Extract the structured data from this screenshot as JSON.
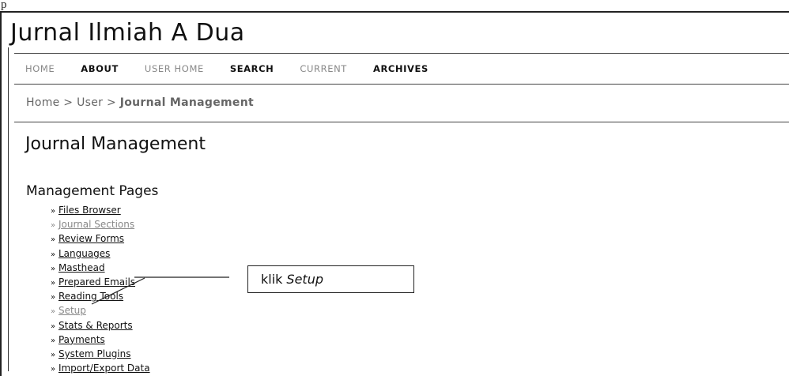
{
  "header": {
    "top_label": "p",
    "journal_title": "Jurnal Ilmiah A Dua"
  },
  "nav": {
    "items": [
      {
        "label": "HOME",
        "style": "muted"
      },
      {
        "label": "ABOUT",
        "style": "active"
      },
      {
        "label": "USER HOME",
        "style": "muted"
      },
      {
        "label": "SEARCH",
        "style": "active"
      },
      {
        "label": "CURRENT",
        "style": "muted"
      },
      {
        "label": "ARCHIVES",
        "style": "active"
      }
    ]
  },
  "breadcrumb": {
    "home": "Home",
    "sep1": " > ",
    "user": "User",
    "sep2": " > ",
    "current": "Journal Management"
  },
  "main": {
    "page_title": "Journal Management",
    "section_title": "Management Pages",
    "arrow": "»",
    "links": [
      {
        "label": "Files Browser",
        "muted": false
      },
      {
        "label": "Journal Sections",
        "muted": true
      },
      {
        "label": "Review Forms",
        "muted": false
      },
      {
        "label": "Languages",
        "muted": false
      },
      {
        "label": "Masthead",
        "muted": false
      },
      {
        "label": "Prepared Emails",
        "muted": false
      },
      {
        "label": "Reading Tools",
        "muted": false
      },
      {
        "label": "Setup",
        "muted": true
      },
      {
        "label": "Stats & Reports",
        "muted": false
      },
      {
        "label": "Payments",
        "muted": false
      },
      {
        "label": "System Plugins",
        "muted": false
      },
      {
        "label": "Import/Export Data",
        "muted": false
      }
    ]
  },
  "callout": {
    "prefix": "klik",
    "target": "Setup"
  }
}
